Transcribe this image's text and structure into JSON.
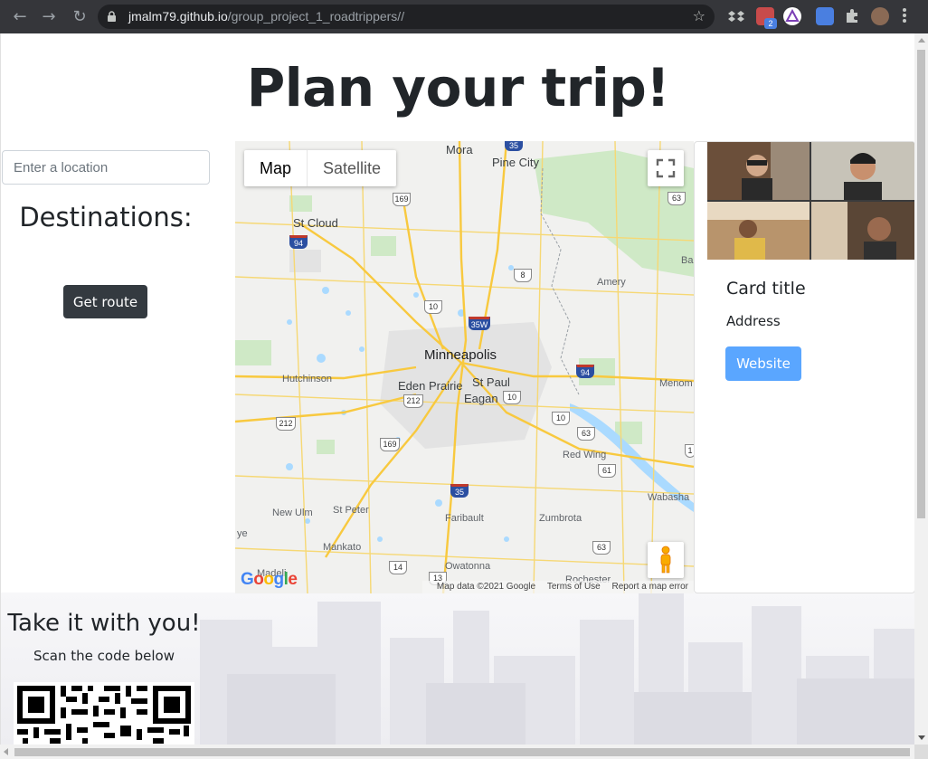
{
  "browser": {
    "url_host": "jmalm79.github.io",
    "url_path": "/group_project_1_roadtrippers//",
    "extension_badge": "2"
  },
  "page": {
    "title": "Plan your trip!",
    "location_placeholder": "Enter a location",
    "destinations_heading": "Destinations:",
    "get_route_label": "Get route"
  },
  "map": {
    "toggle": [
      "Map",
      "Satellite"
    ],
    "attribution": "Map data ©2021 Google",
    "terms": "Terms of Use",
    "report": "Report a map error",
    "logo": "Google",
    "zoom_in": "+",
    "zoom_out": "−",
    "places": {
      "mora": "Mora",
      "pine_city": "Pine City",
      "st_cloud": "St Cloud",
      "amery": "Amery",
      "minneapolis": "Minneapolis",
      "st_paul": "St Paul",
      "eden_prairie": "Eden Prairie",
      "eagan": "Eagan",
      "hutchinson": "Hutchinson",
      "menom": "Menom",
      "red_wing": "Red Wing",
      "new_ulm": "New Ulm",
      "st_peter": "St Peter",
      "faribault": "Faribault",
      "zumbrota": "Zumbrota",
      "mankato": "Mankato",
      "owatonna": "Owatonna",
      "rochester": "Rochester",
      "wabasha": "Wabasha",
      "madel": "Madeli",
      "ba": "Ba",
      "ye": "ye"
    },
    "shields": {
      "s35_top": "35",
      "s169_top": "169",
      "s63_top": "63",
      "s94_w": "94",
      "s8": "8",
      "s10_n": "10",
      "s35w": "35W",
      "s94_e": "94",
      "s212_e": "212",
      "s10_c": "10",
      "s212_w": "212",
      "s169_c": "169",
      "s10_se": "10",
      "s63_c": "63",
      "s61": "61",
      "s35_s": "35",
      "s14": "14",
      "s63_s": "63",
      "s13": "13",
      "s1": "1"
    }
  },
  "card": {
    "title": "Card title",
    "text": "Address",
    "button_label": "Website"
  },
  "footer": {
    "title": "Take it with you!",
    "subtitle": "Scan the code below"
  },
  "colors": {
    "primary_dark": "#343a40",
    "website_button": "#5aa6ff",
    "text": "#212529"
  }
}
